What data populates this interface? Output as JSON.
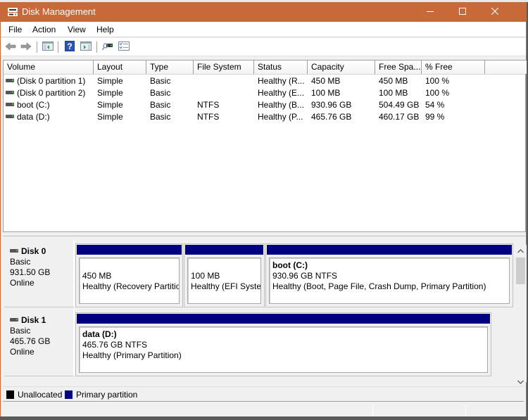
{
  "window": {
    "title": "Disk Management",
    "titlebar_color": "#c8693a",
    "controls": {
      "minimize": "minimize",
      "maximize": "maximize",
      "close": "close"
    }
  },
  "menu": [
    {
      "label": "File"
    },
    {
      "label": "Action"
    },
    {
      "label": "View"
    },
    {
      "label": "Help"
    }
  ],
  "toolbar": [
    {
      "icon": "back-arrow-icon"
    },
    {
      "icon": "forward-arrow-icon"
    },
    {
      "icon": "show-hide-console-tree-icon"
    },
    {
      "icon": "help-icon"
    },
    {
      "icon": "show-hide-action-pane-icon"
    },
    {
      "icon": "connect-disk-icon"
    },
    {
      "icon": "properties-checklist-icon"
    }
  ],
  "volume_list": {
    "columns": [
      "Volume",
      "Layout",
      "Type",
      "File System",
      "Status",
      "Capacity",
      "Free Spa...",
      "% Free"
    ],
    "rows": [
      {
        "volume": "(Disk 0 partition 1)",
        "layout": "Simple",
        "type": "Basic",
        "fs": "",
        "status": "Healthy (R...",
        "capacity": "450 MB",
        "free": "450 MB",
        "pct": "100 %"
      },
      {
        "volume": "(Disk 0 partition 2)",
        "layout": "Simple",
        "type": "Basic",
        "fs": "",
        "status": "Healthy (E...",
        "capacity": "100 MB",
        "free": "100 MB",
        "pct": "100 %"
      },
      {
        "volume": "boot (C:)",
        "layout": "Simple",
        "type": "Basic",
        "fs": "NTFS",
        "status": "Healthy (B...",
        "capacity": "930.96 GB",
        "free": "504.49 GB",
        "pct": "54 %"
      },
      {
        "volume": "data (D:)",
        "layout": "Simple",
        "type": "Basic",
        "fs": "NTFS",
        "status": "Healthy (P...",
        "capacity": "465.76 GB",
        "free": "460.17 GB",
        "pct": "99 %"
      }
    ]
  },
  "disks": [
    {
      "name": "Disk 0",
      "type": "Basic",
      "size": "931.50 GB",
      "state": "Online",
      "partitions": [
        {
          "name": "",
          "size": "450 MB",
          "status": "Healthy (Recovery Partition)"
        },
        {
          "name": "",
          "size": "100 MB",
          "status": "Healthy (EFI System Partition)"
        },
        {
          "name": "boot  (C:)",
          "size": "930.96 GB NTFS",
          "status": "Healthy (Boot, Page File, Crash Dump, Primary Partition)"
        }
      ]
    },
    {
      "name": "Disk 1",
      "type": "Basic",
      "size": "465.76 GB",
      "state": "Online",
      "partitions": [
        {
          "name": "data  (D:)",
          "size": "465.76 GB NTFS",
          "status": "Healthy (Primary Partition)"
        }
      ]
    }
  ],
  "legend": [
    {
      "label": "Unallocated",
      "color": "#000000"
    },
    {
      "label": "Primary partition",
      "color": "#000080"
    }
  ]
}
